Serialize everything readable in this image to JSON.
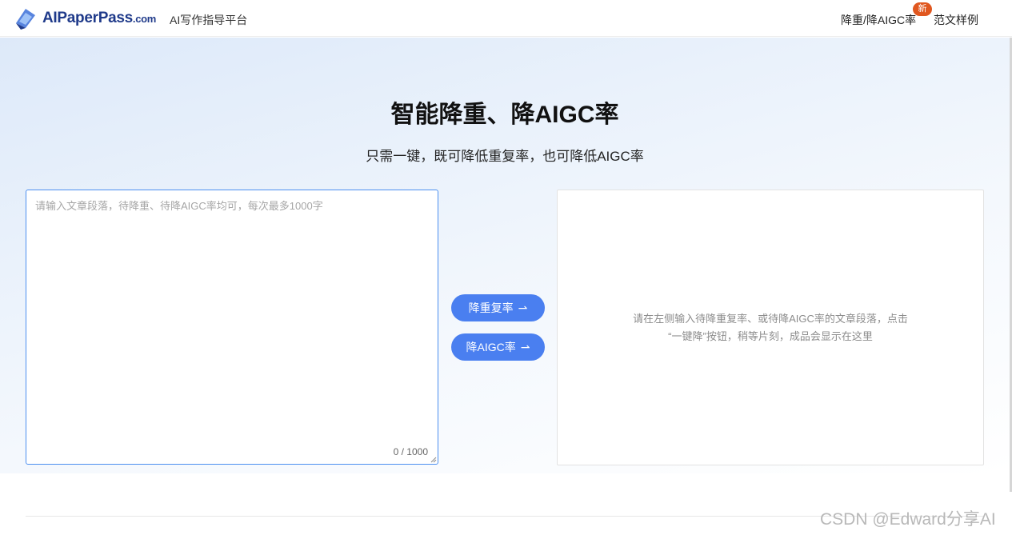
{
  "header": {
    "logo_text": "AIPaperPass",
    "logo_domain": ".com",
    "logo_subtitle": "AI写作指导平台",
    "nav": [
      {
        "label": "降重/降AIGC率",
        "badge": "新"
      },
      {
        "label": "范文样例"
      }
    ]
  },
  "hero": {
    "title": "智能降重、降AIGC率",
    "subtitle": "只需一键，既可降低重复率，也可降低AIGC率"
  },
  "input": {
    "value": "",
    "placeholder": "请输入文章段落，待降重、待降AIGC率均可，每次最多1000字",
    "counter": "0 / 1000"
  },
  "actions": {
    "reduce_duplicate": "降重复率",
    "reduce_aigc": "降AIGC率",
    "arrow": "⇀"
  },
  "output": {
    "hint_line1": "请在左侧输入待降重复率、或待降AIGC率的文章段落，点击",
    "hint_line2": "“一键降”按钮，稍等片刻，成品会显示在这里"
  },
  "watermark": "CSDN @Edward分享AI",
  "colors": {
    "accent": "#4a7ff0",
    "badge": "#e0571f",
    "logo": "#1f3a8a"
  }
}
